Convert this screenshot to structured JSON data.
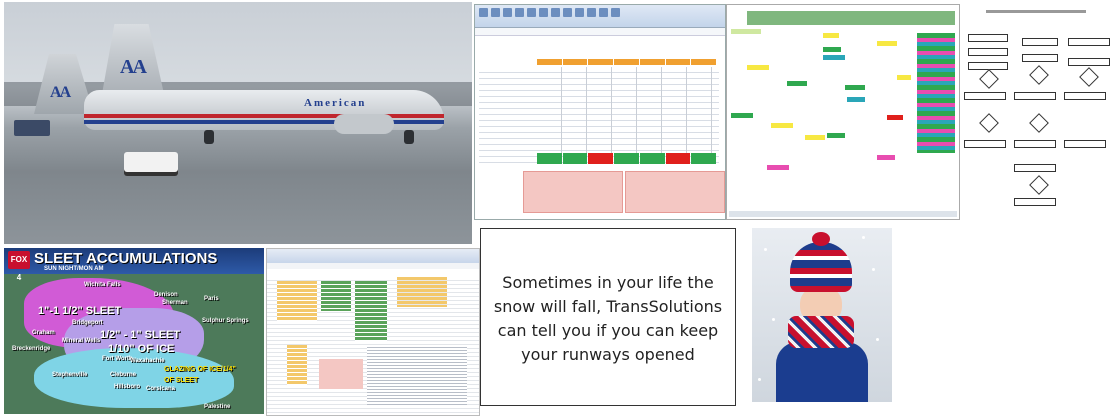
{
  "photo": {
    "livery_text": "American",
    "tail_logo_left": "A",
    "tail_logo_right": "A"
  },
  "weather_map": {
    "station_badge": "FOX 4",
    "title": "SLEET ACCUMULATIONS",
    "subtitle": "SUN NIGHT/MON AM",
    "zones": [
      {
        "label": "1\"-1 1/2\" SLEET"
      },
      {
        "label": "1/2\" - 1\" SLEET"
      },
      {
        "label": "1/10\" OF ICE"
      },
      {
        "label": "GLAZING OF ICE/1/4\" OF SLEET"
      }
    ],
    "cities": [
      "Wichita Falls",
      "Denison",
      "Sherman",
      "Paris",
      "Bridgeport",
      "Sulphur Springs",
      "Graham",
      "Mineral Wells",
      "Breckenridge",
      "Fort Worth",
      "Waxahachie",
      "Stephenville",
      "Cleburne",
      "Hillsboro",
      "Corsicana",
      "Palestine"
    ],
    "colors": {
      "heavy_sleet": "#d15bd6",
      "sleet": "#b59ee8",
      "ice": "#7fd4e6"
    }
  },
  "caption": {
    "text": "Sometimes in your life the snow will fall,  TransSolutions can tell you if you can keep your runways opened"
  },
  "colors": {
    "sheet_header": "#f0a030",
    "status_green": "#2fa84f",
    "status_red": "#e0201c",
    "gantt_header": "#7fb77e"
  }
}
